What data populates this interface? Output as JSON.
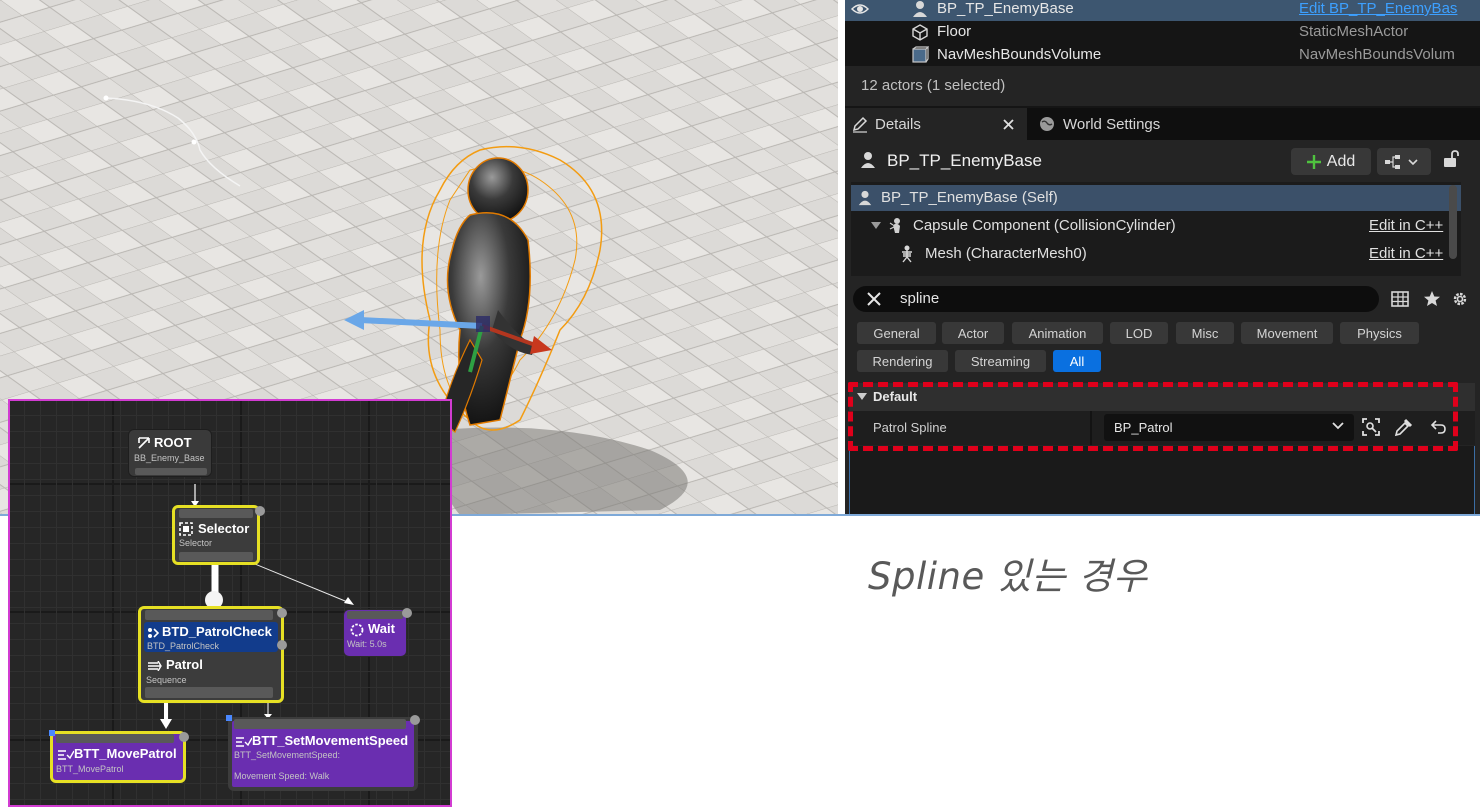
{
  "outliner": {
    "rows": [
      {
        "name": "BP_TP_EnemyBase",
        "type": "Edit BP_TP_EnemyBas",
        "icon": "character-icon",
        "selected": true
      },
      {
        "name": "Floor",
        "type": "StaticMeshActor",
        "icon": "static-mesh-icon",
        "selected": false
      },
      {
        "name": "NavMeshBoundsVolume",
        "type": "NavMeshBoundsVolum",
        "icon": "volume-icon",
        "selected": false
      }
    ],
    "actor_count": "12 actors (1 selected)"
  },
  "tabs": {
    "details": "Details",
    "world_settings": "World Settings"
  },
  "details": {
    "actor_name": "BP_TP_EnemyBase",
    "add_label": "Add",
    "components": [
      {
        "label": "BP_TP_EnemyBase (Self)",
        "edit": ""
      },
      {
        "label": "Capsule Component (CollisionCylinder)",
        "edit": "Edit in C++"
      },
      {
        "label": "Mesh (CharacterMesh0)",
        "edit": "Edit in C++"
      }
    ],
    "search_value": "spline",
    "filters": [
      "General",
      "Actor",
      "Animation",
      "LOD",
      "Misc",
      "Movement",
      "Physics",
      "Rendering",
      "Streaming",
      "All"
    ],
    "active_filter": "All",
    "category": "Default",
    "property": {
      "name": "Patrol Spline",
      "value": "BP_Patrol"
    }
  },
  "caption": "Spline 있는 경우",
  "behavior_tree": {
    "root": {
      "title": "ROOT",
      "sub": "BB_Enemy_Base"
    },
    "selector": {
      "title": "Selector",
      "sub": "Selector"
    },
    "patrol_check": {
      "title": "BTD_PatrolCheck",
      "sub": "BTD_PatrolCheck"
    },
    "patrol": {
      "title": "Patrol",
      "sub": "Sequence"
    },
    "wait": {
      "title": "Wait",
      "sub": "Wait: 5.0s"
    },
    "move_patrol": {
      "title": "BTT_MovePatrol",
      "sub": "BTT_MovePatrol"
    },
    "set_speed": {
      "title": "BTT_SetMovementSpeed",
      "sub": "BTT_SetMovementSpeed:",
      "detail": "Movement Speed: Walk"
    }
  },
  "colors": {
    "selection_highlight": "#3d5670",
    "active_filter": "#0a70e0",
    "highlight_box": "#e0001b",
    "active_node_border": "#e6e024",
    "task_node": "#6a2eb0",
    "decorator_node": "#123c8c"
  }
}
